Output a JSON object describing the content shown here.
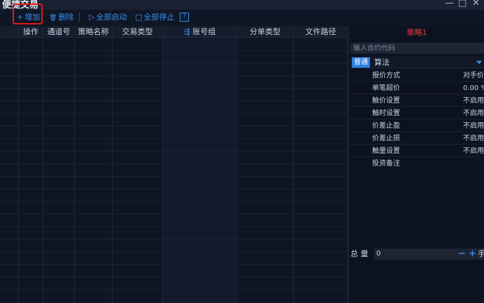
{
  "window": {
    "title": "便捷交易",
    "minimize_glyph": "—",
    "maximize_glyph": "□",
    "close_glyph": "✕"
  },
  "toolbar": {
    "add_label": "增加",
    "add_icon": "+",
    "delete_label": "删除",
    "delete_icon": "🗑",
    "start_all_label": "全部启动",
    "start_all_icon": "▷",
    "stop_all_label": "全部停止",
    "stop_all_icon": "□",
    "help_label": "?"
  },
  "grid": {
    "columns": [
      "操作",
      "通道号",
      "策略名称",
      "交易类型",
      "账号组",
      "分单类型",
      "文件路径"
    ],
    "account_group_icon": "⇶"
  },
  "panel": {
    "title": "策略1",
    "code_placeholder": "输入合约代码",
    "mode_normal": "普通",
    "mode_algo": "算法",
    "params": [
      {
        "label": "报价方式",
        "value": "对手价"
      },
      {
        "label": "单笔超价",
        "value": "0.00 %"
      },
      {
        "label": "触价设置",
        "value": "不启用"
      },
      {
        "label": "触时设置",
        "value": "不启用"
      },
      {
        "label": "价差止盈",
        "value": "不启用"
      },
      {
        "label": "价差止损",
        "value": "不启用"
      },
      {
        "label": "触量设置",
        "value": "不启用"
      },
      {
        "label": "投资备注",
        "value": ""
      }
    ],
    "quantity_label": "总 量",
    "quantity_value": "0",
    "quantity_minus": "−",
    "quantity_plus": "+",
    "quantity_unit": "手"
  },
  "colors": {
    "accent": "#3a8ee8",
    "strategy_title": "#e83a3a",
    "highlight_box": "#e01a1a",
    "background": "#0d1220"
  }
}
